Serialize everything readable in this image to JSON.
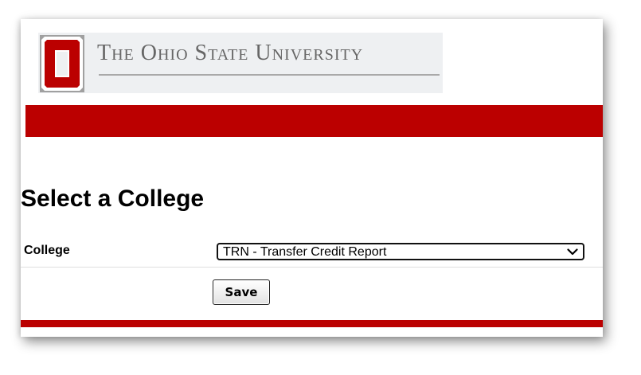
{
  "logo": {
    "wordmark": "The Ohio State University",
    "icon": "block-o-icon"
  },
  "page": {
    "title": "Select a College"
  },
  "form": {
    "college_label": "College",
    "college_selected": "TRN - Transfer Credit Report",
    "save_label": "Save"
  },
  "colors": {
    "scarlet": "#bb0000",
    "gray": "#666666",
    "banner_bg": "#eef0f2"
  }
}
